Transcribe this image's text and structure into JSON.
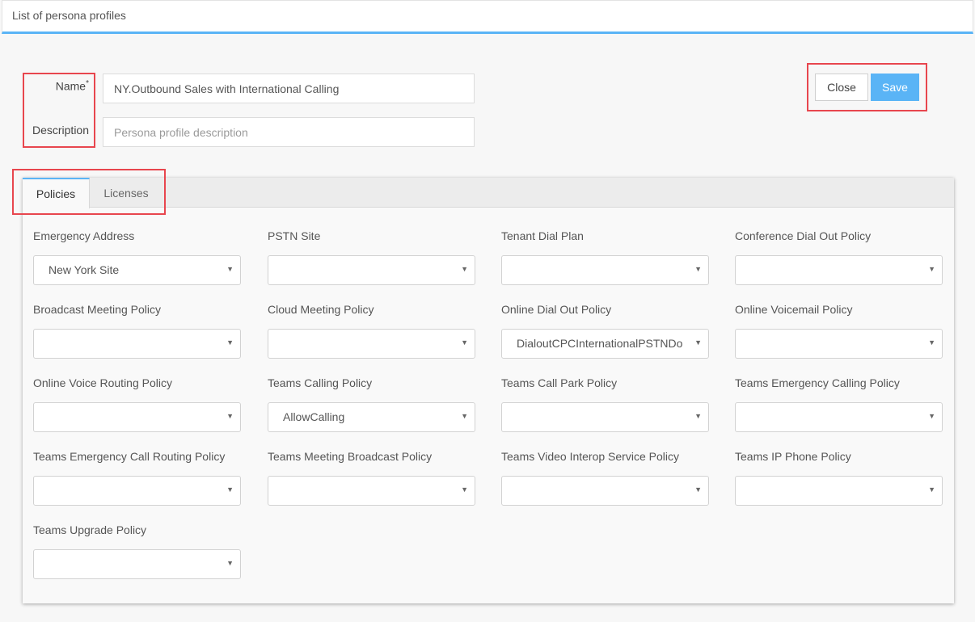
{
  "header": {
    "title": "List of persona profiles"
  },
  "form": {
    "name_label": "Name",
    "required_mark": "*",
    "name_value": "NY.Outbound Sales with International Calling",
    "description_label": "Description",
    "description_placeholder": "Persona profile description"
  },
  "actions": {
    "close_label": "Close",
    "save_label": "Save"
  },
  "tabs": [
    {
      "label": "Policies",
      "active": true
    },
    {
      "label": "Licenses",
      "active": false
    }
  ],
  "policies": [
    {
      "label": "Emergency Address",
      "value": "New York Site"
    },
    {
      "label": "PSTN Site",
      "value": ""
    },
    {
      "label": "Tenant Dial Plan",
      "value": ""
    },
    {
      "label": "Conference Dial Out Policy",
      "value": ""
    },
    {
      "label": "Broadcast Meeting Policy",
      "value": ""
    },
    {
      "label": "Cloud Meeting Policy",
      "value": ""
    },
    {
      "label": "Online Dial Out Policy",
      "value": "DialoutCPCInternationalPSTNDomestic"
    },
    {
      "label": "Online Voicemail Policy",
      "value": ""
    },
    {
      "label": "Online Voice Routing Policy",
      "value": ""
    },
    {
      "label": "Teams Calling Policy",
      "value": "AllowCalling"
    },
    {
      "label": "Teams Call Park Policy",
      "value": ""
    },
    {
      "label": "Teams Emergency Calling Policy",
      "value": ""
    },
    {
      "label": "Teams Emergency Call Routing Policy",
      "value": ""
    },
    {
      "label": "Teams Meeting Broadcast Policy",
      "value": ""
    },
    {
      "label": "Teams Video Interop Service Policy",
      "value": ""
    },
    {
      "label": "Teams IP Phone Policy",
      "value": ""
    },
    {
      "label": "Teams Upgrade Policy",
      "value": ""
    }
  ],
  "icons": {
    "dropdown": "caret-down-icon"
  },
  "colors": {
    "accent": "#5ab4f6",
    "highlight": "#e8464e"
  }
}
